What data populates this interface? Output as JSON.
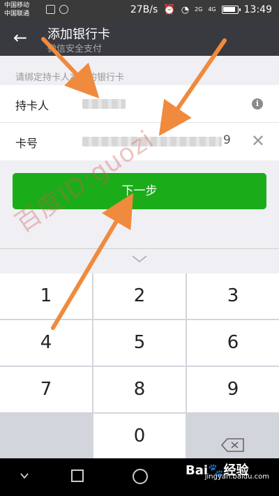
{
  "status_bar": {
    "carrier1": "中国移动",
    "carrier2": "中国联通",
    "speed": "27B/s",
    "net2g": "2G",
    "net4g": "4G",
    "time": "13:49"
  },
  "header": {
    "back_icon": "arrow-left-icon",
    "title": "添加银行卡",
    "subtitle": "微信安全支付"
  },
  "hint": "请绑定持卡人本人的银行卡",
  "form": {
    "cardholder_label": "持卡人",
    "cardno_label": "卡号",
    "cardno_suffix": "9"
  },
  "next_button": "下一步",
  "keypad": {
    "keys": [
      "1",
      "2",
      "3",
      "4",
      "5",
      "6",
      "7",
      "8",
      "9",
      "0"
    ],
    "delete_icon": "backspace-icon"
  },
  "watermark": "百度ID:guozi",
  "brand": {
    "logo": "Bai",
    "logo_suffix": "经验",
    "site": "jingyan.baidu.com"
  },
  "colors": {
    "header_bg": "#393a3f",
    "button_green": "#1aad19",
    "arrow_orange": "#f08a3c"
  }
}
